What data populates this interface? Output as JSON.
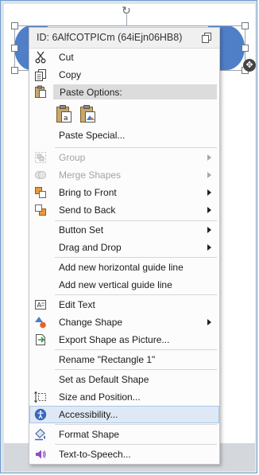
{
  "shape": {
    "fill_color": "#4f7fc6",
    "rotate_icon": "rotate-handle-icon",
    "move_icon": "move-cross-icon"
  },
  "menu": {
    "id_text": "ID: 6AlfCOTPICm  (64iEjn06HB8)",
    "items": {
      "cut": "Cut",
      "copy": "Copy",
      "paste_options": "Paste Options:",
      "paste_special": "Paste Special...",
      "group": "Group",
      "merge_shapes": "Merge Shapes",
      "bring_to_front": "Bring to Front",
      "send_to_back": "Send to Back",
      "button_set": "Button Set",
      "drag_and_drop": "Drag and Drop",
      "add_horizontal_guide": "Add new horizontal guide line",
      "add_vertical_guide": "Add new vertical guide line",
      "edit_text": "Edit Text",
      "change_shape": "Change Shape",
      "export_shape": "Export Shape as Picture...",
      "rename": "Rename \"Rectangle 1\"",
      "set_default_shape": "Set as Default Shape",
      "size_and_position": "Size and Position...",
      "accessibility": "Accessibility...",
      "format_shape": "Format Shape",
      "text_to_speech": "Text-to-Speech..."
    },
    "highlighted_item": "Accessibility...",
    "colors": {
      "highlight_bg": "#dfe9f5",
      "highlight_border": "#a8c6e8",
      "disabled_text": "#a3a3a3"
    }
  }
}
